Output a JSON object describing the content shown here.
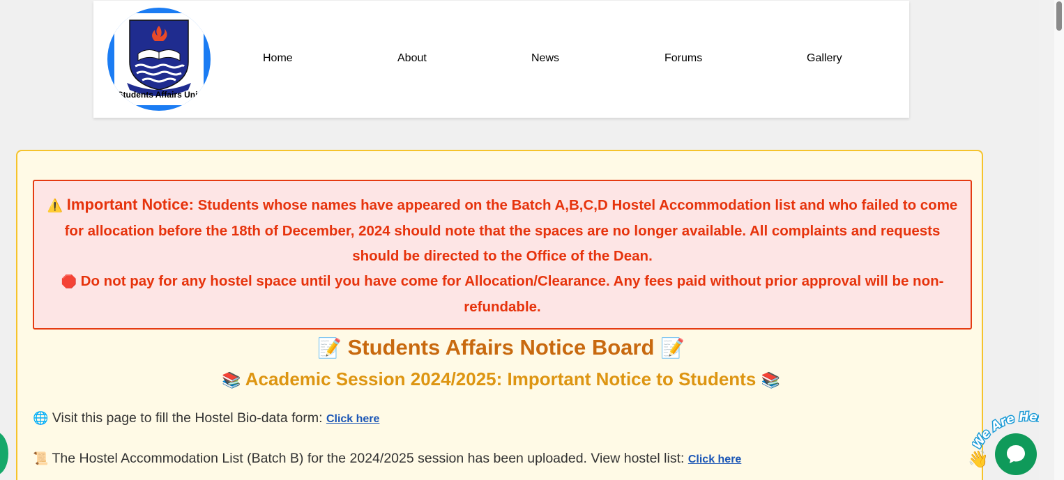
{
  "header": {
    "logo_text": "Students Affairs Unit",
    "nav": [
      "Home",
      "About",
      "News",
      "Forums",
      "Gallery"
    ]
  },
  "alert": {
    "icon_warning": "⚠️",
    "label": "Important Notice:",
    "message": "Students whose names have appeared on the Batch A,B,C,D Hostel Accommodation list and who failed to come for allocation before the 18th of December, 2024 should note that the spaces are no longer available. All complaints and requests should be directed to the Office of the Dean.",
    "icon_stop": "🛑",
    "message2": "Do not pay for any hostel space until you have come for Allocation/Clearance. Any fees paid without prior approval will be non-refundable."
  },
  "board": {
    "title": "Students Affairs Notice Board",
    "title_icon": "📝",
    "subtitle": "Academic Session 2024/2025: Important Notice to Students",
    "subtitle_icon": "📚",
    "items": [
      {
        "icon": "🌐",
        "text": "Visit this page to fill the Hostel Bio-data form:",
        "link": "Click here"
      },
      {
        "icon": "📜",
        "text": "The Hostel Accommodation List (Batch B) for the 2024/2025 session has been uploaded. View hostel list:",
        "link": "Click here"
      }
    ]
  },
  "chat": {
    "badge_text": "We Are Here!",
    "wave_icon": "👋"
  },
  "colors": {
    "alert_text": "#e6330c",
    "alert_bg": "#fde5e5",
    "board_bg": "#fffae6",
    "board_border": "#f5c32c",
    "title": "#c8690f",
    "subtitle": "#dd9512",
    "link": "#1a55b5",
    "chat": "#0f9a5a",
    "logo_ring": "#1b7cf3"
  }
}
